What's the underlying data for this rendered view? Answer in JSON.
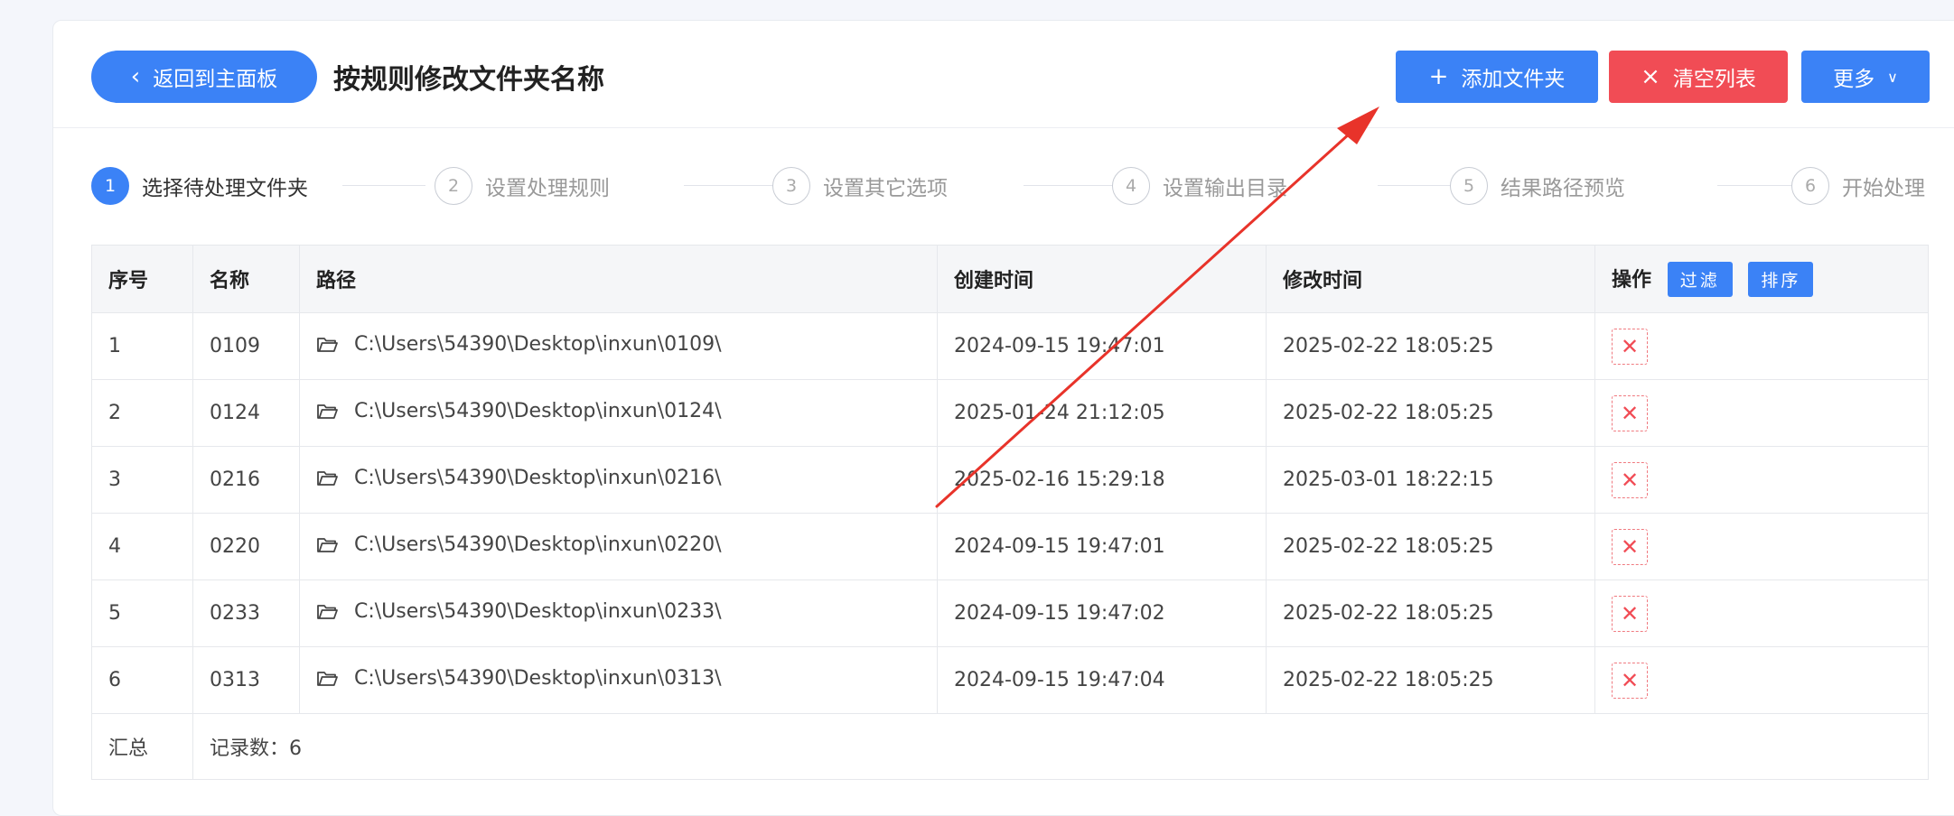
{
  "header": {
    "back_label": "返回到主面板",
    "title": "按规则修改文件夹名称",
    "add_folder_label": "添加文件夹",
    "clear_list_label": "清空列表",
    "more_label": "更多"
  },
  "steps": [
    {
      "num": "1",
      "label": "选择待处理文件夹",
      "active": true
    },
    {
      "num": "2",
      "label": "设置处理规则",
      "active": false
    },
    {
      "num": "3",
      "label": "设置其它选项",
      "active": false
    },
    {
      "num": "4",
      "label": "设置输出目录",
      "active": false
    },
    {
      "num": "5",
      "label": "结果路径预览",
      "active": false
    },
    {
      "num": "6",
      "label": "开始处理",
      "active": false
    }
  ],
  "table": {
    "headers": {
      "index": "序号",
      "name": "名称",
      "path": "路径",
      "created": "创建时间",
      "modified": "修改时间",
      "actions": "操作",
      "filter": "过滤",
      "sort": "排序"
    },
    "rows": [
      {
        "index": "1",
        "name": "0109",
        "path": "C:\\Users\\54390\\Desktop\\inxun\\0109\\",
        "created": "2024-09-15 19:47:01",
        "modified": "2025-02-22 18:05:25"
      },
      {
        "index": "2",
        "name": "0124",
        "path": "C:\\Users\\54390\\Desktop\\inxun\\0124\\",
        "created": "2025-01-24 21:12:05",
        "modified": "2025-02-22 18:05:25"
      },
      {
        "index": "3",
        "name": "0216",
        "path": "C:\\Users\\54390\\Desktop\\inxun\\0216\\",
        "created": "2025-02-16 15:29:18",
        "modified": "2025-03-01 18:22:15"
      },
      {
        "index": "4",
        "name": "0220",
        "path": "C:\\Users\\54390\\Desktop\\inxun\\0220\\",
        "created": "2024-09-15 19:47:01",
        "modified": "2025-02-22 18:05:25"
      },
      {
        "index": "5",
        "name": "0233",
        "path": "C:\\Users\\54390\\Desktop\\inxun\\0233\\",
        "created": "2024-09-15 19:47:02",
        "modified": "2025-02-22 18:05:25"
      },
      {
        "index": "6",
        "name": "0313",
        "path": "C:\\Users\\54390\\Desktop\\inxun\\0313\\",
        "created": "2024-09-15 19:47:04",
        "modified": "2025-02-22 18:05:25"
      }
    ],
    "summary": {
      "label": "汇总",
      "records": "记录数：6"
    }
  },
  "icons": {
    "back": "chevron-left-icon",
    "add": "plus-icon",
    "clear": "close-icon",
    "more": "chevron-down-icon",
    "folder": "folder-open-icon",
    "delete": "delete-x-icon"
  },
  "colors": {
    "primary": "#3b82f6",
    "danger": "#f14c55",
    "annotation_arrow": "#e8332a"
  }
}
